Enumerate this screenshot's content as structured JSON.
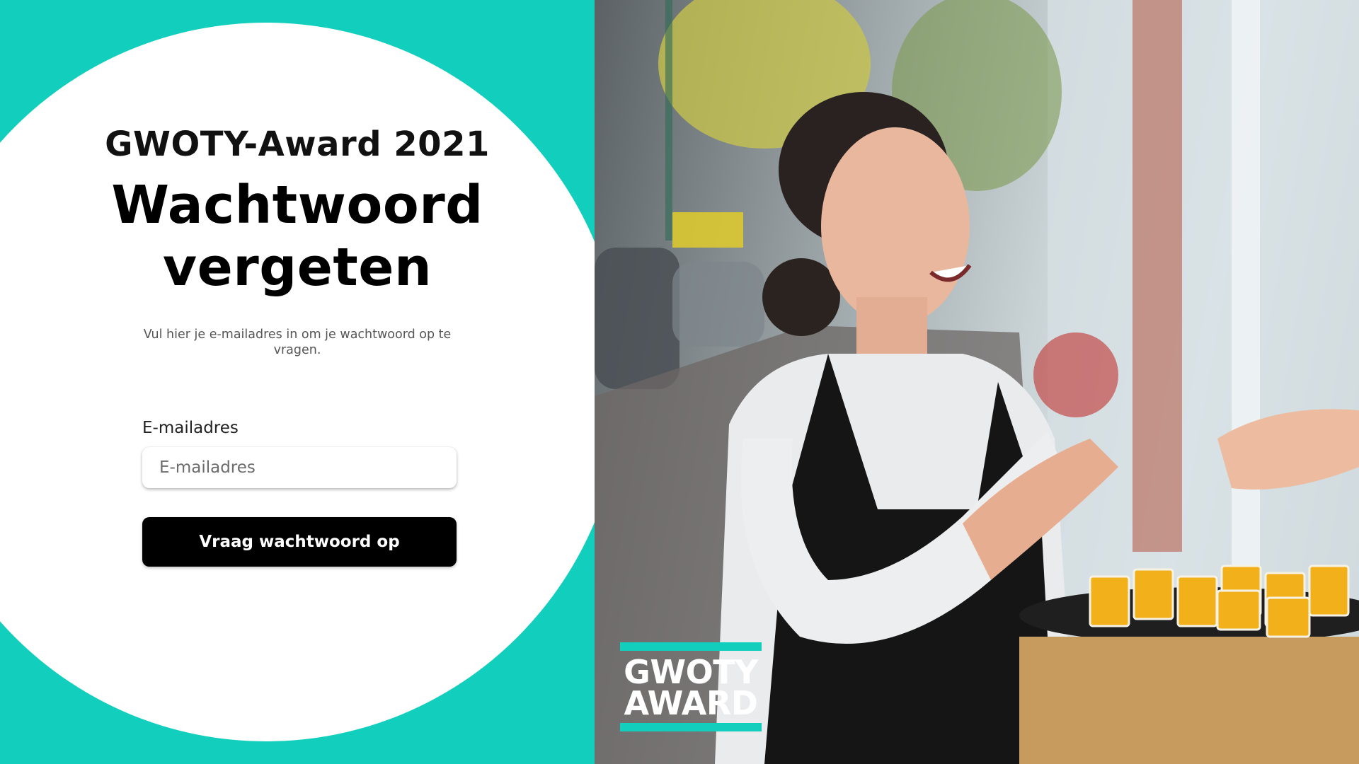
{
  "colors": {
    "accent": "#12cfbd",
    "button_bg": "#000000",
    "panel_bg": "#ffffff"
  },
  "form": {
    "award_title": "GWOTY-Award 2021",
    "heading_line1": "Wachtwoord",
    "heading_line2": "vergeten",
    "subtitle": "Vul hier je e-mailadres in om je wachtwoord op te vragen.",
    "email_label": "E-mailadres",
    "email_placeholder": "E-mailadres",
    "email_value": "",
    "submit_label": "Vraag wachtwoord op"
  },
  "photo": {
    "logo_line1": "GWOTY",
    "logo_line2": "AWARD"
  }
}
